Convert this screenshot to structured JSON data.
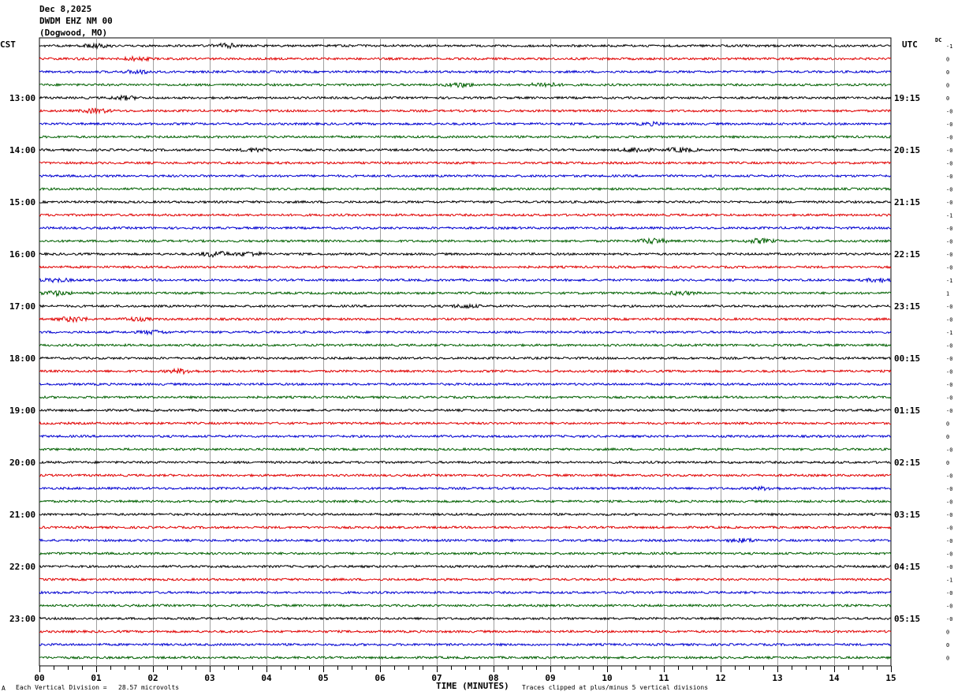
{
  "header": {
    "date": "Dec 8,2025",
    "station": "DWDM EHZ NM 00",
    "location": "(Dogwood, MO)"
  },
  "left_tz": "CST",
  "right_tz": "UTC",
  "dc_label": "DC",
  "footer": {
    "mark": "A",
    "scale": "Each Vertical Division =   28.57 microvolts",
    "clip": "Traces clipped at plus/minus 5 vertical divisions"
  },
  "colors": {
    "trace": [
      "#000000",
      "#e00000",
      "#0000d0",
      "#006000"
    ],
    "grid": "#a0a0a0"
  },
  "chart_data": {
    "type": "line",
    "title": "DWDM EHZ NM 00",
    "xlabel": "TIME (MINUTES)",
    "ylabel": "",
    "x_ticks": [
      "00",
      "01",
      "02",
      "03",
      "04",
      "05",
      "06",
      "07",
      "08",
      "09",
      "10",
      "11",
      "12",
      "13",
      "14",
      "15"
    ],
    "xlim": [
      0,
      15
    ],
    "trace_count": 48,
    "left_hour_labels": [
      {
        "trace": 4,
        "label": "13:00"
      },
      {
        "trace": 8,
        "label": "14:00"
      },
      {
        "trace": 12,
        "label": "15:00"
      },
      {
        "trace": 16,
        "label": "16:00"
      },
      {
        "trace": 20,
        "label": "17:00"
      },
      {
        "trace": 24,
        "label": "18:00"
      },
      {
        "trace": 28,
        "label": "19:00"
      },
      {
        "trace": 32,
        "label": "20:00"
      },
      {
        "trace": 36,
        "label": "21:00"
      },
      {
        "trace": 40,
        "label": "22:00"
      },
      {
        "trace": 44,
        "label": "23:00"
      }
    ],
    "right_hour_labels": [
      {
        "trace": 4,
        "label": "19:15"
      },
      {
        "trace": 8,
        "label": "20:15"
      },
      {
        "trace": 12,
        "label": "21:15"
      },
      {
        "trace": 16,
        "label": "22:15"
      },
      {
        "trace": 20,
        "label": "23:15"
      },
      {
        "trace": 24,
        "label": "00:15"
      },
      {
        "trace": 28,
        "label": "01:15"
      },
      {
        "trace": 32,
        "label": "02:15"
      },
      {
        "trace": 36,
        "label": "03:15"
      },
      {
        "trace": 40,
        "label": "04:15"
      },
      {
        "trace": 44,
        "label": "05:15"
      }
    ],
    "dc_offsets": [
      "-1",
      "0",
      "0",
      "0",
      "0",
      "-0",
      "-0",
      "-0",
      "-0",
      "-0",
      "-0",
      "-0",
      "-0",
      "-1",
      "-0",
      "-0",
      "-0",
      "-0",
      "-1",
      "1",
      "-0",
      "-0",
      "-1",
      "-0",
      "-0",
      "-0",
      "-0",
      "-0",
      "-0",
      "0",
      "0",
      "-0",
      "0",
      "-0",
      "-0",
      "-0",
      "-0",
      "-0",
      "-0",
      "-0",
      "-0",
      "-1",
      "-0",
      "-0",
      "-0",
      "0",
      "0",
      "0"
    ],
    "activity": [
      {
        "trace": 0,
        "minute": 1.0,
        "amp": 2.0
      },
      {
        "trace": 0,
        "minute": 3.3,
        "amp": 2.5
      },
      {
        "trace": 1,
        "minute": 1.7,
        "amp": 2.0
      },
      {
        "trace": 2,
        "minute": 1.75,
        "amp": 2.0
      },
      {
        "trace": 3,
        "minute": 7.4,
        "amp": 2.5
      },
      {
        "trace": 3,
        "minute": 8.9,
        "amp": 2.5
      },
      {
        "trace": 4,
        "minute": 1.5,
        "amp": 2.0
      },
      {
        "trace": 5,
        "minute": 1.0,
        "amp": 2.5
      },
      {
        "trace": 6,
        "minute": 10.8,
        "amp": 1.5
      },
      {
        "trace": 8,
        "minute": 3.8,
        "amp": 2.0
      },
      {
        "trace": 8,
        "minute": 10.5,
        "amp": 3.0
      },
      {
        "trace": 8,
        "minute": 11.3,
        "amp": 2.5
      },
      {
        "trace": 15,
        "minute": 10.8,
        "amp": 3.0
      },
      {
        "trace": 15,
        "minute": 12.7,
        "amp": 2.5
      },
      {
        "trace": 16,
        "minute": 3.1,
        "amp": 3.5
      },
      {
        "trace": 16,
        "minute": 3.7,
        "amp": 2.5
      },
      {
        "trace": 18,
        "minute": 0.3,
        "amp": 2.0
      },
      {
        "trace": 18,
        "minute": 14.8,
        "amp": 2.0
      },
      {
        "trace": 19,
        "minute": 0.3,
        "amp": 2.5
      },
      {
        "trace": 19,
        "minute": 11.3,
        "amp": 2.0
      },
      {
        "trace": 20,
        "minute": 7.5,
        "amp": 2.0
      },
      {
        "trace": 21,
        "minute": 0.6,
        "amp": 3.0
      },
      {
        "trace": 21,
        "minute": 1.7,
        "amp": 2.0
      },
      {
        "trace": 22,
        "minute": 2.0,
        "amp": 2.0
      },
      {
        "trace": 25,
        "minute": 2.5,
        "amp": 2.5
      },
      {
        "trace": 38,
        "minute": 12.4,
        "amp": 2.0
      },
      {
        "trace": 34,
        "minute": 12.8,
        "amp": 1.5
      }
    ]
  }
}
